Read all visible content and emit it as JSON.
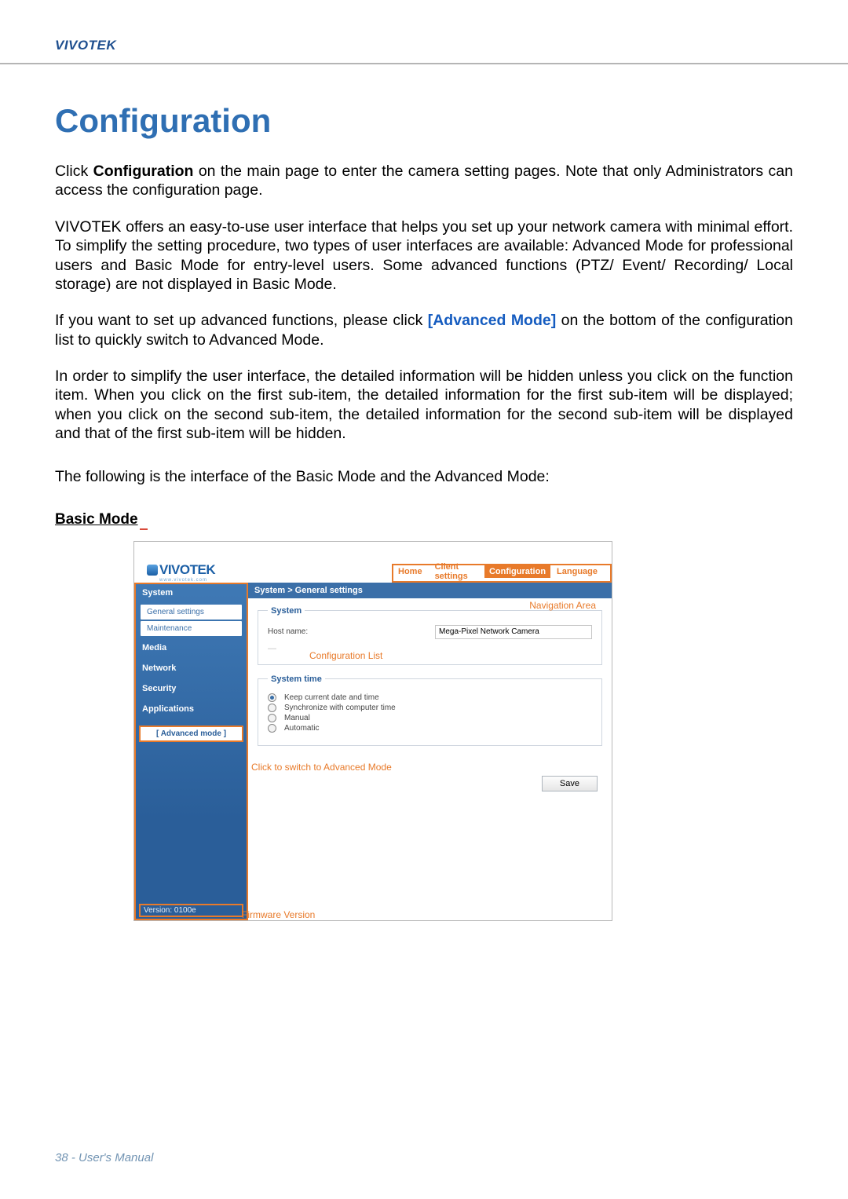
{
  "brand": "VIVOTEK",
  "title": "Configuration",
  "paragraphs": {
    "p1a": "Click ",
    "p1b": "Configuration",
    "p1c": " on the main page to enter the camera setting pages. Note that only Administrators can access the configuration page.",
    "p2": "VIVOTEK offers an easy-to-use user interface that helps you set up your network camera with minimal effort. To simplify the setting procedure, two types of user interfaces are available: Advanced Mode for professional users and Basic Mode for entry-level users. Some advanced functions (PTZ/ Event/ Recording/ Local storage) are not displayed in Basic Mode.",
    "p3a": "If you want to set up advanced functions, please click ",
    "p3b": "[Advanced Mode]",
    "p3c": " on the bottom of the configuration list to quickly switch to Advanced Mode.",
    "p4": "In order to simplify the user interface, the detailed information will be hidden unless you click on the function item. When you click on the first sub-item, the detailed information for the first sub-item will be displayed; when you click on the second sub-item, the detailed information for the second sub-item will be displayed and that of the first sub-item will be hidden.",
    "p5": "The following is the interface of the Basic Mode and the Advanced Mode:"
  },
  "section_heading": "Basic Mode",
  "shot": {
    "logo_text": "VIVOTEK",
    "logo_sub": "www.vivotek.com",
    "topnav": {
      "home": "Home",
      "client": "Client settings",
      "config": "Configuration",
      "lang": "Language"
    },
    "breadcrumb": "System  >  General settings",
    "sidebar": {
      "system": "System",
      "general": "General settings",
      "maintenance": "Maintenance",
      "media": "Media",
      "network": "Network",
      "security": "Security",
      "applications": "Applications",
      "advanced": "[ Advanced mode ]",
      "version": "Version: 0100e"
    },
    "panel": {
      "system_legend": "System",
      "hostname_label": "Host name:",
      "hostname_value": "Mega-Pixel Network Camera",
      "time_legend": "System time",
      "opt_keep": "Keep current date and time",
      "opt_sync": "Synchronize with computer time",
      "opt_manual": "Manual",
      "opt_auto": "Automatic",
      "save": "Save"
    },
    "annotations": {
      "nav_area": "Navigation Area",
      "config_list": "Configuration List",
      "switch": "Click to switch to Advanced Mode",
      "fw": "Firmware Version"
    }
  },
  "footer": "38 - User's Manual"
}
